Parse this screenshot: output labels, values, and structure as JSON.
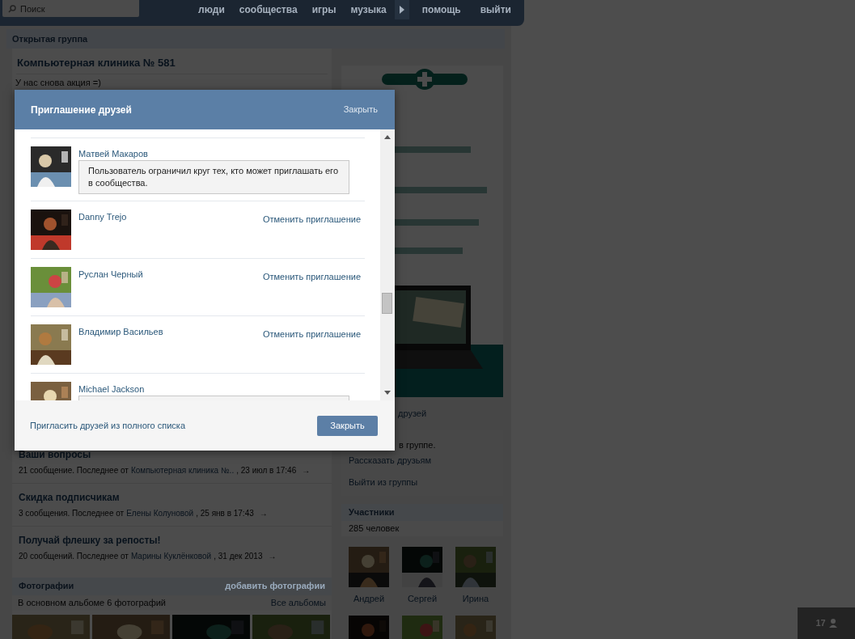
{
  "header": {
    "search": {
      "placeholder": "Поиск"
    },
    "nav_left": [
      {
        "label": "люди"
      },
      {
        "label": "сообщества"
      },
      {
        "label": "игры"
      },
      {
        "label": "музыка"
      }
    ],
    "nav_right": [
      {
        "label": "помощь"
      },
      {
        "label": "выйти"
      }
    ]
  },
  "group": {
    "type_label": "Открытая группа",
    "title": "Компьютерная клиника № 581",
    "status": "У нас снова акция =)"
  },
  "topics": [
    {
      "title": "Ваши вопросы",
      "count": "21 сообщение.",
      "last": "Последнее от",
      "author": "Компьютерная клиника №..",
      "date": ", 23 июл в 17:46",
      "arrow": "→"
    },
    {
      "title": "Скидка подписчикам",
      "count": "3 сообщения.",
      "last": "Последнее от",
      "author": "Елены Колуновой",
      "date": ", 25 янв в 17:43",
      "arrow": "→"
    },
    {
      "title": "Получай флешку за репосты!",
      "count": "20 сообщений.",
      "last": "Последнее от",
      "author": "Марины Куклёнковой",
      "date": ", 31 дек 2013",
      "arrow": "→"
    }
  ],
  "photos": {
    "title": "Фотографии",
    "add": "добавить фотографии",
    "summary": "В основном альбоме 6 фотографий",
    "all": "Все альбомы"
  },
  "sidebar": {
    "invite_fragment": "друзей",
    "membership_fragment": "в группе.",
    "links": [
      {
        "label": "Рассказать друзьям"
      },
      {
        "label": "Выйти из группы"
      }
    ],
    "members": {
      "title": "Участники",
      "count": "285 человек",
      "people": [
        {
          "name": "Андрей"
        },
        {
          "name": "Сергей"
        },
        {
          "name": "Ирина"
        }
      ]
    }
  },
  "modal": {
    "title": "Приглашение друзей",
    "close_link": "Закрыть",
    "friends": [
      {
        "name": "Матвей Макаров",
        "kind": "restricted",
        "note": "Пользователь ограничил круг тех, кто может приглашать его в сообщества."
      },
      {
        "name": "Danny Trejo",
        "kind": "invited",
        "action": "Отменить приглашение"
      },
      {
        "name": "Руслан Черный",
        "kind": "invited",
        "action": "Отменить приглашение"
      },
      {
        "name": "Владимир Васильев",
        "kind": "invited",
        "action": "Отменить приглашение"
      },
      {
        "name": "Michael Jackson",
        "kind": "restricted"
      }
    ],
    "footer_link": "Пригласить друзей из полного списка",
    "close_button": "Закрыть"
  },
  "counter": {
    "count": "17"
  }
}
